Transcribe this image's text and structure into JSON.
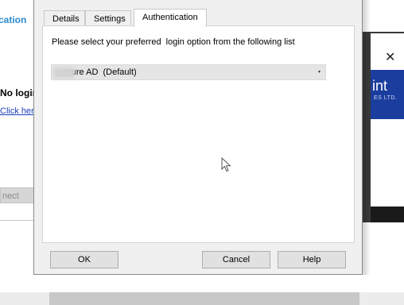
{
  "background": {
    "left_title": "cation",
    "no_login": "No login",
    "click_here": "Click here",
    "connect_button": "nect",
    "banner_text": "int",
    "banner_sub": "ES LTD.",
    "close_glyph": "✕"
  },
  "dialog": {
    "tabs": [
      {
        "label": "Details"
      },
      {
        "label": "Settings"
      },
      {
        "label": "Authentication"
      }
    ],
    "active_tab": "Authentication",
    "instruction": "Please select your preferred  login option from the following list",
    "login_option": {
      "selected_value": "     zure AD  (Default)",
      "chevron_glyph": "▾"
    },
    "buttons": {
      "ok": "OK",
      "cancel": "Cancel",
      "help": "Help"
    }
  },
  "colors": {
    "link": "#1a3fb8",
    "title_accent": "#2a8ad0",
    "banner": "#1b3d9e"
  }
}
